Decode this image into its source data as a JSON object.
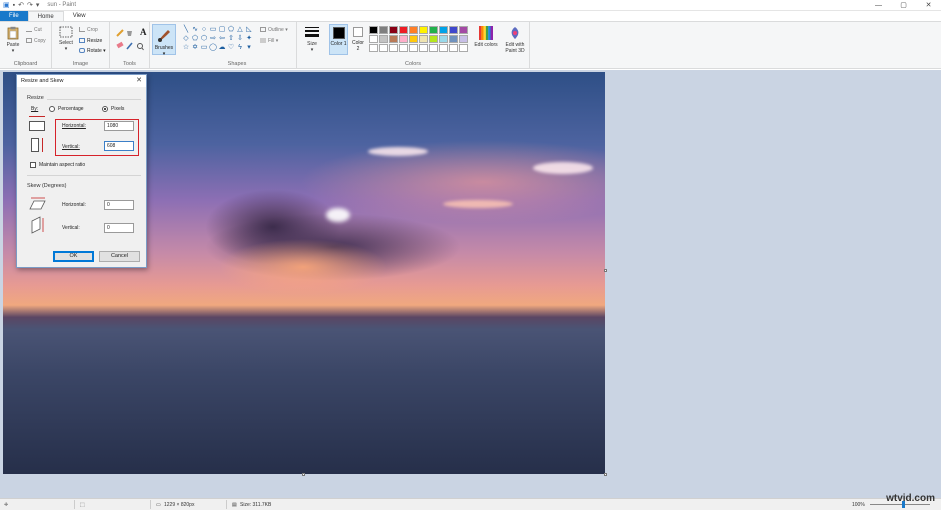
{
  "window": {
    "title": "sun - Paint",
    "controls": {
      "minimize": "—",
      "maximize": "▢",
      "close": "✕"
    }
  },
  "quick_access": {
    "save_icon": "save-icon",
    "undo_icon": "undo-icon",
    "redo_icon": "redo-icon"
  },
  "ribbon_tabs": [
    "File",
    "Home",
    "View"
  ],
  "ribbon": {
    "clipboard": {
      "label": "Clipboard",
      "paste": "Paste",
      "cut": "Cut",
      "copy": "Copy"
    },
    "image": {
      "label": "Image",
      "select": "Select",
      "crop": "Crop",
      "resize": "Resize",
      "rotate": "Rotate"
    },
    "tools": {
      "label": "Tools",
      "text_glyph": "A"
    },
    "brushes": {
      "label": "Brushes"
    },
    "shapes": {
      "label": "Shapes",
      "outline": "Outline",
      "fill": "Fill"
    },
    "size": {
      "label": "Size"
    },
    "colors": {
      "label": "Colors",
      "color1": "Color 1",
      "color2": "Color 2",
      "edit_colors": "Edit colors",
      "edit_with_paint3d": "Edit with Paint 3D",
      "palette": [
        "#000000",
        "#7f7f7f",
        "#880015",
        "#ed1c24",
        "#ff7f27",
        "#fff200",
        "#22b14c",
        "#00a2e8",
        "#3f48cc",
        "#a349a4",
        "#ffffff",
        "#c3c3c3",
        "#b97a57",
        "#ffaec9",
        "#ffc90e",
        "#efe4b0",
        "#b5e61d",
        "#99d9ea",
        "#7092be",
        "#c8bfe7",
        "#ffffff",
        "#ffffff",
        "#ffffff",
        "#ffffff",
        "#ffffff",
        "#ffffff",
        "#ffffff",
        "#ffffff",
        "#ffffff",
        "#ffffff"
      ]
    }
  },
  "dialog": {
    "title": "Resize and Skew",
    "resize_section": "Resize",
    "by_label": "By:",
    "percentage_label": "Percentage",
    "pixels_label": "Pixels",
    "selected_unit": "Pixels",
    "horizontal_label": "Horizontal:",
    "vertical_label": "Vertical:",
    "horizontal_value": "1080",
    "vertical_value": "608",
    "maintain_aspect_label": "Maintain aspect ratio",
    "maintain_aspect_checked": false,
    "skew_section": "Skew (Degrees)",
    "skew_horizontal_label": "Horizontal:",
    "skew_vertical_label": "Vertical:",
    "skew_horizontal_value": "0",
    "skew_vertical_value": "0",
    "ok_label": "OK",
    "cancel_label": "Cancel"
  },
  "status_bar": {
    "dimensions": "1229 × 820px",
    "size": "Size: 311.7KB",
    "zoom": "100%"
  },
  "watermark": "wtvid.com"
}
